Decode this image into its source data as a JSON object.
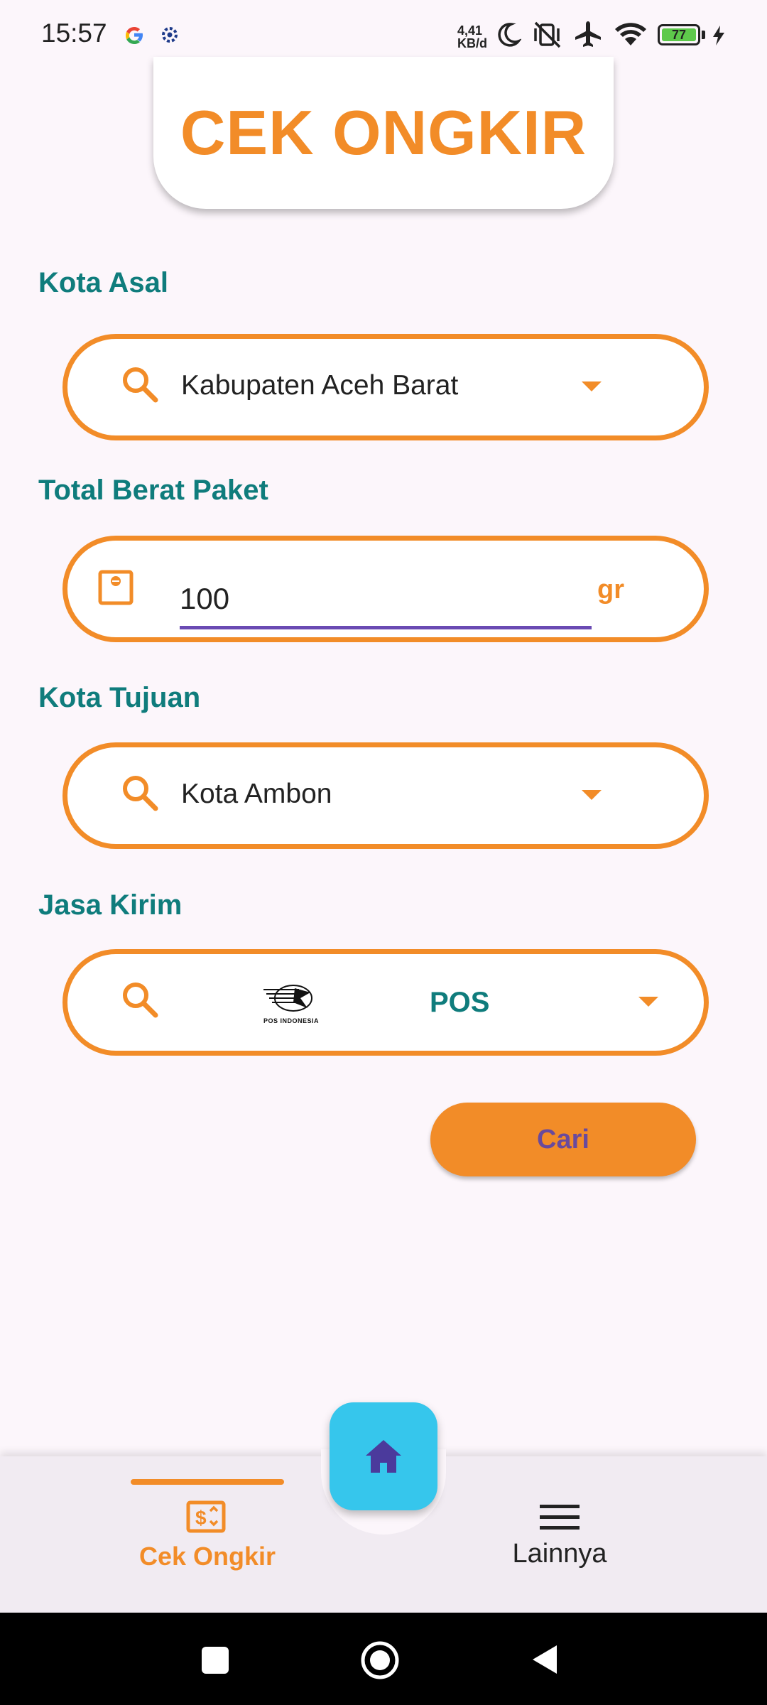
{
  "status_bar": {
    "time": "15:57",
    "net_speed_value": "4,41",
    "net_speed_unit": "KB/d",
    "battery": "77",
    "icons": [
      "google-icon",
      "settings-gear-icon",
      "moon-icon",
      "vibrate-off-icon",
      "airplane-icon",
      "wifi-icon",
      "battery-icon",
      "charging-icon"
    ]
  },
  "header": {
    "title": "CEK ONGKIR"
  },
  "form": {
    "origin": {
      "label": "Kota Asal",
      "value": "Kabupaten Aceh Barat",
      "icon": "search-icon"
    },
    "weight": {
      "label": "Total Berat Paket",
      "value": "100",
      "unit": "gr",
      "icon": "scale-icon"
    },
    "destination": {
      "label": "Kota Tujuan",
      "value": "Kota Ambon",
      "icon": "search-icon"
    },
    "courier": {
      "label": "Jasa Kirim",
      "value": "POS",
      "logo_text": "POS INDONESIA",
      "icon": "search-icon"
    },
    "search_button": "Cari"
  },
  "bottom_nav": {
    "items": [
      {
        "label": "Cek Ongkir",
        "icon": "dollar-card-icon",
        "active": true
      },
      {
        "label": "Lainnya",
        "icon": "menu-icon",
        "active": false
      }
    ],
    "fab_icon": "home-icon"
  },
  "colors": {
    "accent": "#f28c28",
    "label_teal": "#0f7c7c",
    "fab": "#36c6ec",
    "button_text": "#6a4a9c"
  }
}
